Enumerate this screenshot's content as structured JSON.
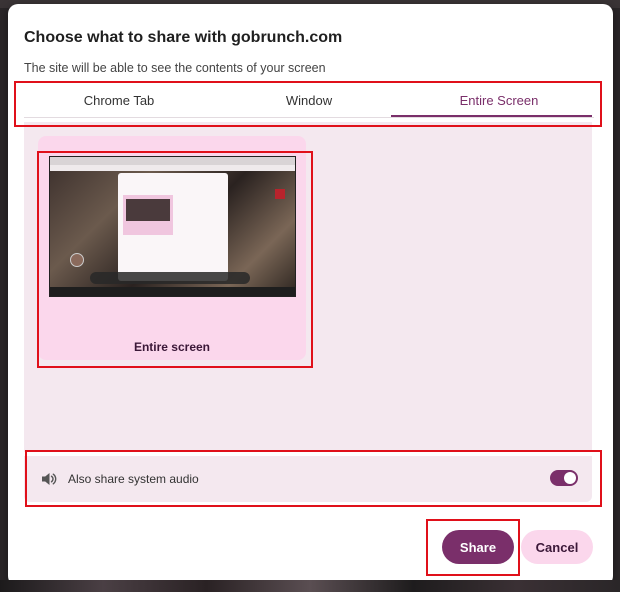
{
  "dialog": {
    "title": "Choose what to share with gobrunch.com",
    "subtitle": "The site will be able to see the contents of your screen"
  },
  "tabs": [
    {
      "label": "Chrome Tab",
      "active": false
    },
    {
      "label": "Window",
      "active": false
    },
    {
      "label": "Entire Screen",
      "active": true
    }
  ],
  "source": {
    "label": "Entire screen",
    "selected": true
  },
  "audio": {
    "icon": "speaker-icon",
    "label": "Also share system audio",
    "enabled": true
  },
  "actions": {
    "share_label": "Share",
    "cancel_label": "Cancel"
  },
  "colors": {
    "accent": "#7a2f6a",
    "card": "#fbd7ec",
    "panel": "#f4e8ef",
    "annotation": "#e0101a"
  }
}
